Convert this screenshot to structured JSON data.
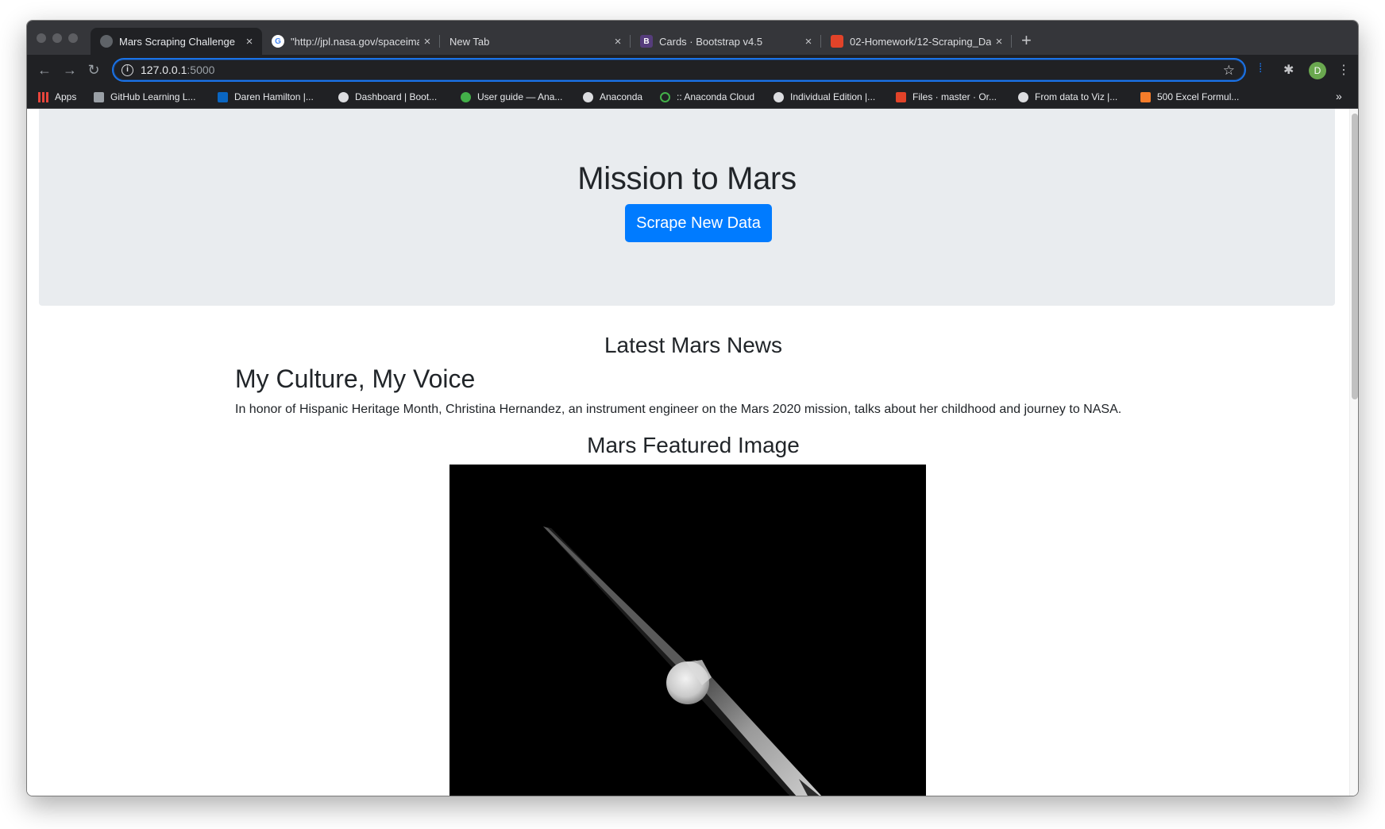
{
  "browser": {
    "tabs": [
      {
        "title": "Mars Scraping Challenge",
        "active": true,
        "favicon": "globe-icon",
        "close": "×"
      },
      {
        "title": "\"http://jpl.nasa.gov/spaceimag",
        "favicon": "google-icon",
        "close": "×"
      },
      {
        "title": "New Tab",
        "favicon": "",
        "close": "×"
      },
      {
        "title": "Cards · Bootstrap v4.5",
        "favicon": "bootstrap-icon",
        "favicon_letter": "B",
        "close": "×"
      },
      {
        "title": "02-Homework/12-Scraping_Da",
        "favicon": "gitlab-icon",
        "close": "×"
      }
    ],
    "new_tab": "+",
    "url_host": "127.0.0.1",
    "url_port": ":5000",
    "avatar_letter": "D",
    "bookmarks": [
      {
        "label": "Apps",
        "icon": "apps-grid-icon",
        "color": "#e8453c"
      },
      {
        "label": "GitHub Learning L...",
        "icon": "github-learning-icon",
        "color": "#9aa0a6"
      },
      {
        "label": "Daren Hamilton |...",
        "icon": "linkedin-icon",
        "color": "#0a66c2"
      },
      {
        "label": "Dashboard | Boot...",
        "icon": "globe-icon",
        "color": "#dcdde0"
      },
      {
        "label": "User guide — Ana...",
        "icon": "anaconda-icon",
        "color": "#43b049"
      },
      {
        "label": "Anaconda",
        "icon": "globe-icon",
        "color": "#dcdde0"
      },
      {
        "label": ":: Anaconda Cloud",
        "icon": "anaconda-cloud-icon",
        "color": "#43b049"
      },
      {
        "label": "Individual Edition |...",
        "icon": "globe-icon",
        "color": "#dcdde0"
      },
      {
        "label": "Files · master · Or...",
        "icon": "gitlab-icon",
        "color": "#e24329"
      },
      {
        "label": "From data to Viz |...",
        "icon": "globe-icon",
        "color": "#dcdde0"
      },
      {
        "label": "500 Excel Formul...",
        "icon": "excel-formulas-icon",
        "color": "#f57c2a"
      }
    ],
    "bookmarks_overflow": "»",
    "accent": "#1a73e8"
  },
  "page": {
    "jumbotron_title": "Mission to Mars",
    "scrape_button": "Scrape New Data",
    "news_heading": "Latest Mars News",
    "news_title": "My Culture, My Voice",
    "news_paragraph": "In honor of Hispanic Heritage Month, Christina Hernandez, an instrument engineer on the Mars 2020 mission, talks about her childhood and journey to NASA.",
    "featured_heading": "Mars Featured Image",
    "button_color": "#007bff",
    "jumbotron_color": "#e9ecef"
  }
}
